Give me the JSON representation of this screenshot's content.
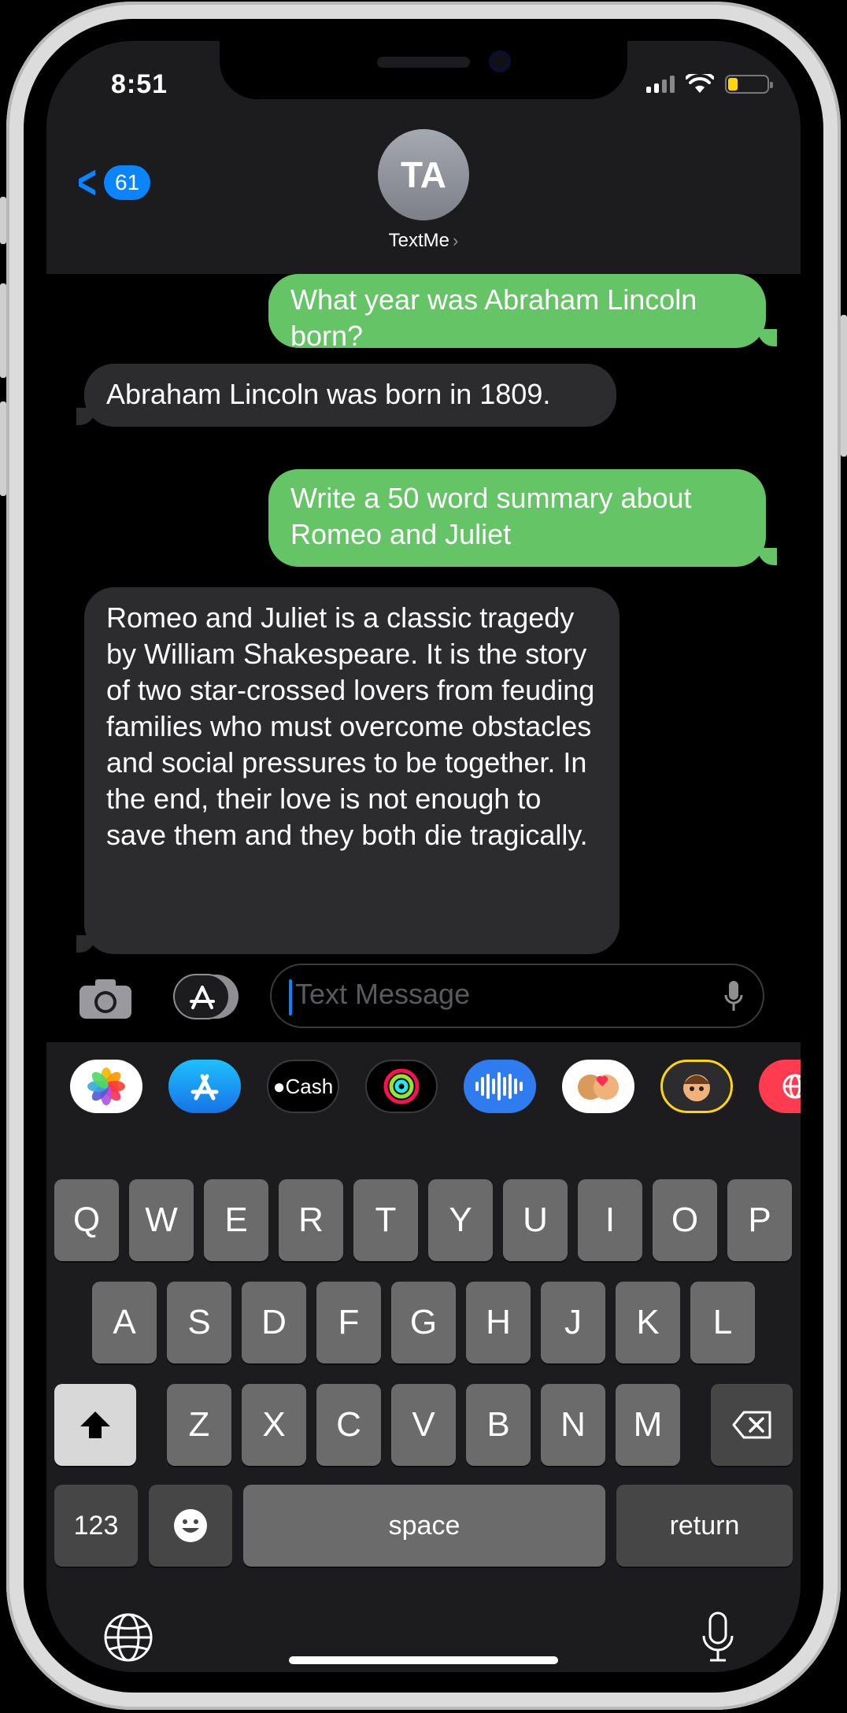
{
  "status_bar": {
    "time": "8:51"
  },
  "header": {
    "back_count": "61",
    "avatar_initials": "TA",
    "contact_name": "TextMe",
    "contact_chevron": "›"
  },
  "messages": [
    {
      "direction": "outgoing",
      "text": "What year was Abraham Lincoln born?"
    },
    {
      "direction": "incoming",
      "text": "Abraham Lincoln was born in 1809."
    },
    {
      "direction": "outgoing",
      "text": "Write a 50 word summary about Romeo and Juliet"
    },
    {
      "direction": "incoming",
      "text": "Romeo and Juliet is a classic tragedy by William Shakespeare. It is the story of two star-crossed lovers from feuding families who must overcome obstacles and social pressures to be together. In the end, their love is not enough to save them and they both die tragically."
    }
  ],
  "input": {
    "placeholder": "Text Message"
  },
  "app_strip": {
    "apps": [
      "photos-icon",
      "app-store-icon",
      "apple-cash-icon",
      "activity-icon",
      "audio-message-icon",
      "memoji-stickers-icon",
      "animoji-icon",
      "web-search-icon"
    ],
    "cash_label": "Cash"
  },
  "keyboard": {
    "row1": [
      "Q",
      "W",
      "E",
      "R",
      "T",
      "Y",
      "U",
      "I",
      "O",
      "P"
    ],
    "row2": [
      "A",
      "S",
      "D",
      "F",
      "G",
      "H",
      "J",
      "K",
      "L"
    ],
    "row3": [
      "Z",
      "X",
      "C",
      "V",
      "B",
      "N",
      "M"
    ],
    "numbers_label": "123",
    "space_label": "space",
    "return_label": "return"
  },
  "colors": {
    "outgoing_bubble": "#65c466",
    "incoming_bubble": "#2c2c2e",
    "accent": "#0a84ff"
  }
}
